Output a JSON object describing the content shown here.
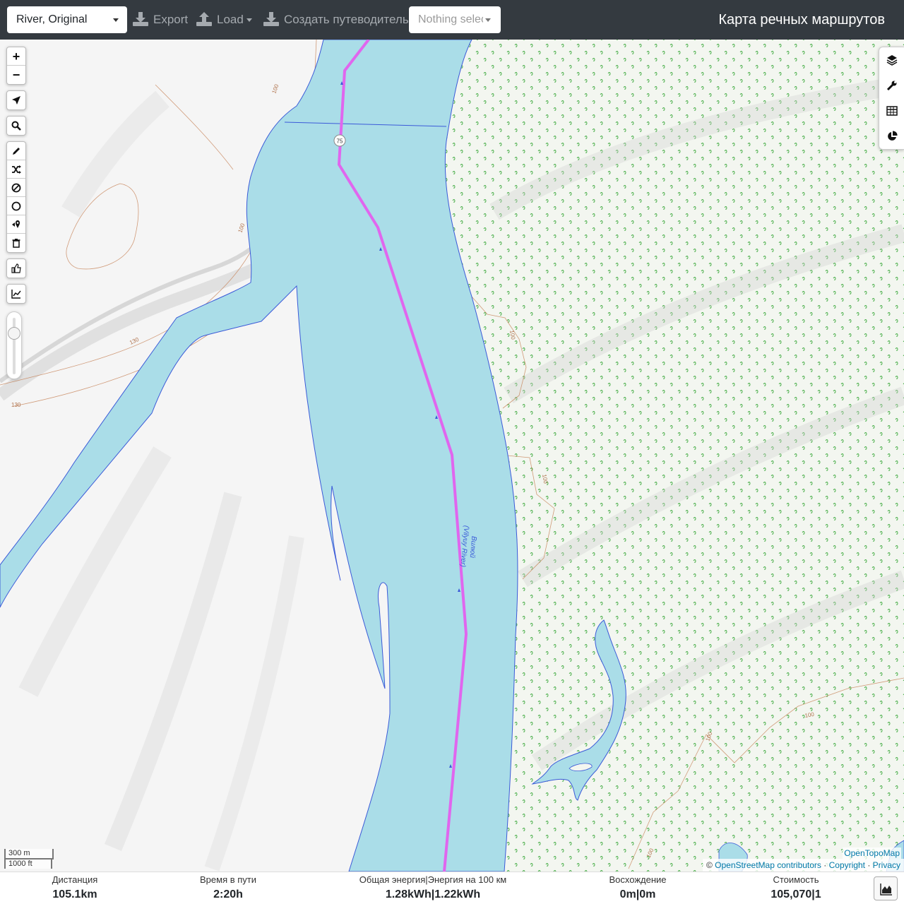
{
  "navbar": {
    "profile": "River, Original",
    "export_label": "Export",
    "load_label": "Load",
    "guide_label": "Создать путеводитель",
    "nothing_selected": "Nothing selected",
    "app_title": "Карта речных маршрутов"
  },
  "map_labels": {
    "route_number": "75",
    "river_name": "Вилюй",
    "river_name_en": "(Vilyuy River)",
    "contour_labels": [
      "100",
      "100",
      "130",
      "130",
      "100",
      "100",
      "100",
      "100",
      "100"
    ]
  },
  "map_controls": {
    "zoom_in": "+",
    "zoom_out": "−"
  },
  "scale": {
    "metric": "300 m",
    "imperial": "1000 ft"
  },
  "attribution": {
    "tiles": "OpenTopoMap",
    "copy_symbol": "©",
    "osm": "OpenStreetMap contributors",
    "sep": "·",
    "copyright": "Copyright",
    "privacy": "Privacy"
  },
  "stats": {
    "distance_title": "Дистанция",
    "distance_num": "105.1",
    "distance_unit": "km",
    "time_title": "Время в пути",
    "time_num": "2:20",
    "time_unit": "h",
    "energy_title": "Общая энергия|Энергия на 100 км",
    "energy_total_num": "1.28",
    "energy_total_unit": "kWh",
    "energy_sep": "|",
    "energy_per100_num": "1.22",
    "energy_per100_unit": "kWh",
    "ascent_title": "Восхождение",
    "ascent_num": "0",
    "ascent_unit": "m",
    "ascent_sep": "|",
    "descent_num": "0",
    "descent_unit": "m",
    "cost_title": "Стоимость",
    "cost_num": "105,070",
    "cost_sep": "|",
    "cost_count": "1"
  },
  "colors": {
    "navbar": "#343a40",
    "water": "#aadde8",
    "route": "#e066ee",
    "forest_mark": "#3aa83a",
    "contour": "#c7845a"
  }
}
